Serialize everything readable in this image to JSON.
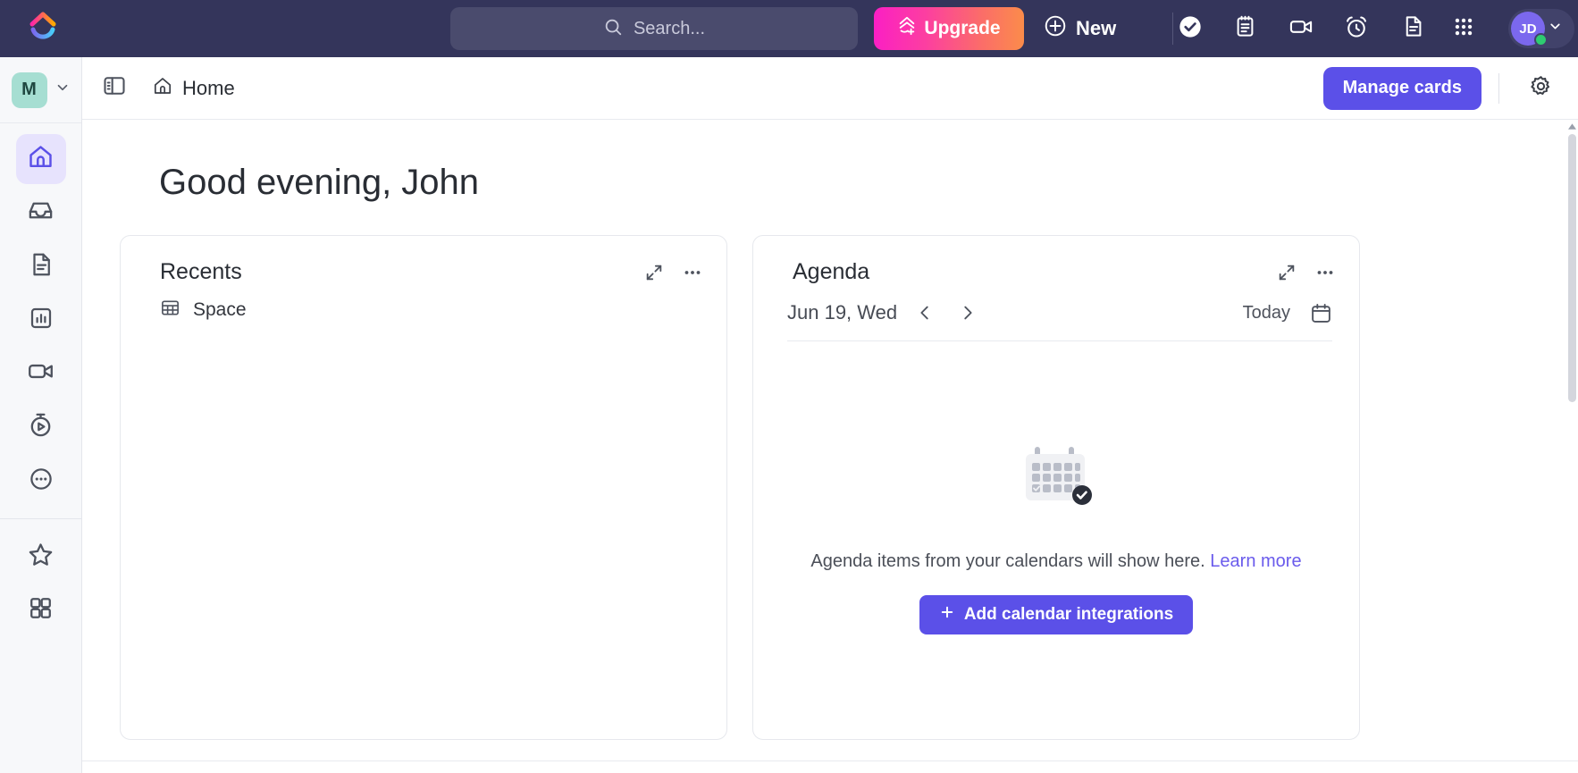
{
  "topbar": {
    "logo_icon": "clickup-logo-icon",
    "search": {
      "placeholder": "Search...",
      "icon": "search-icon"
    },
    "upgrade_label": "Upgrade",
    "upgrade_icon": "upgrade-rocket-icon",
    "new_label": "New",
    "new_icon": "plus-circle-icon",
    "icons": [
      {
        "name": "task-check-icon",
        "label": "Tasks"
      },
      {
        "name": "notepad-icon",
        "label": "Notepad"
      },
      {
        "name": "video-camera-icon",
        "label": "Clip"
      },
      {
        "name": "alarm-clock-icon",
        "label": "Reminders"
      },
      {
        "name": "document-icon",
        "label": "Docs"
      },
      {
        "name": "apps-grid-icon",
        "label": "Apps"
      }
    ],
    "avatar_initials": "JD",
    "avatar_chevron_icon": "chevron-down-icon",
    "status": "online",
    "accent_purple": "#7B68EE",
    "bar_bg": "#34355b"
  },
  "rail": {
    "workspace_initial": "M",
    "workspace_chevron_icon": "chevron-down-icon",
    "items": [
      {
        "icon": "home-icon",
        "label": "Home",
        "active": true
      },
      {
        "icon": "inbox-icon",
        "label": "Inbox",
        "active": false
      },
      {
        "icon": "docs-icon",
        "label": "Docs",
        "active": false
      },
      {
        "icon": "dashboards-icon",
        "label": "Dashboards",
        "active": false
      },
      {
        "icon": "clips-icon",
        "label": "Clips",
        "active": false
      },
      {
        "icon": "timesheets-icon",
        "label": "Timesheets",
        "active": false
      },
      {
        "icon": "more-dots-icon",
        "label": "More",
        "active": false
      }
    ],
    "bottom_items": [
      {
        "icon": "star-icon",
        "label": "Favorites"
      },
      {
        "icon": "spaces-grid-icon",
        "label": "Spaces"
      }
    ]
  },
  "header": {
    "panel_toggle_icon": "sidebar-toggle-icon",
    "breadcrumb_icon": "home-icon",
    "breadcrumb_label": "Home",
    "manage_cards_label": "Manage cards",
    "settings_icon": "gear-icon",
    "button_color": "#5b50e8"
  },
  "main": {
    "greeting": "Good evening, John",
    "recents": {
      "title": "Recents",
      "expand_icon": "expand-arrows-icon",
      "more_icon": "ellipsis-icon",
      "items": [
        {
          "icon": "table-grid-icon",
          "label": "Space"
        }
      ]
    },
    "agenda": {
      "title": "Agenda",
      "expand_icon": "expand-arrows-icon",
      "more_icon": "ellipsis-icon",
      "date": "Jun 19, Wed",
      "prev_icon": "chevron-left-icon",
      "next_icon": "chevron-right-icon",
      "today_label": "Today",
      "calendar_icon": "calendar-icon",
      "empty_illustration": "calendar-check-illustration",
      "empty_text": "Agenda items from your calendars will show here.",
      "empty_link": "Learn more",
      "add_button_label": "Add calendar integrations",
      "add_button_icon": "plus-icon"
    }
  },
  "scrollbar": {
    "up_icon": "scroll-up-arrow-icon",
    "down_icon": "scroll-down-arrow-icon"
  }
}
